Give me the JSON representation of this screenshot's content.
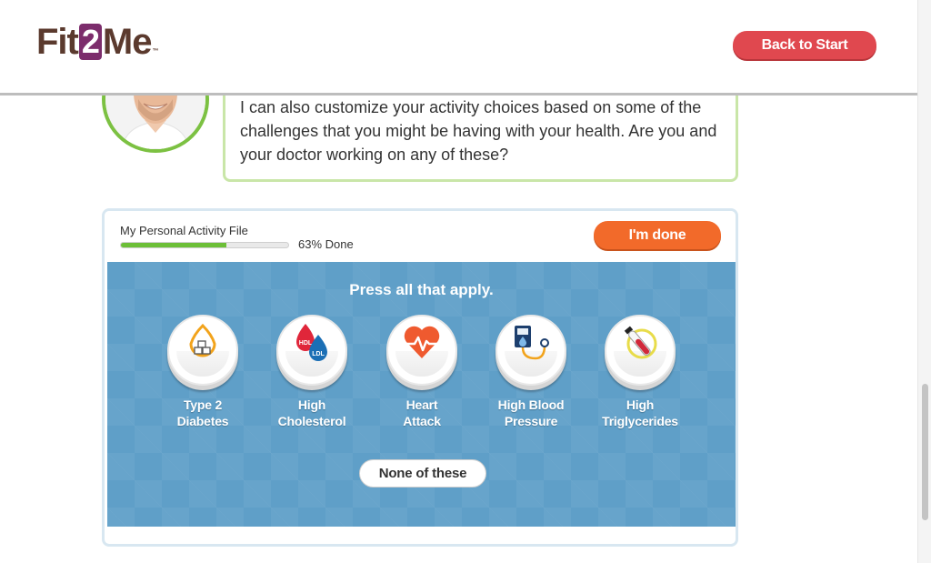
{
  "header": {
    "logo": {
      "part1": "Fit",
      "part2": "2",
      "part3": "Me",
      "tm": "™"
    },
    "back_button": "Back to Start"
  },
  "coach": {
    "message": "I can also customize your activity choices based on some of the challenges that you might be having with your health. Are you and your doctor working on any of these?"
  },
  "activity_file": {
    "title": "My Personal Activity File",
    "progress_percent": 63,
    "progress_text": "63% Done",
    "done_button": "I'm done"
  },
  "question": {
    "instruction": "Press all that apply.",
    "options": [
      {
        "label_line1": "Type 2",
        "label_line2": "Diabetes",
        "icon": "sugar-cubes-icon"
      },
      {
        "label_line1": "High",
        "label_line2": "Cholesterol",
        "icon": "cholesterol-drops-icon",
        "icon_text_1": "HDL",
        "icon_text_2": "LDL"
      },
      {
        "label_line1": "Heart",
        "label_line2": "Attack",
        "icon": "heart-pulse-icon"
      },
      {
        "label_line1": "High Blood",
        "label_line2": "Pressure",
        "icon": "blood-pressure-monitor-icon"
      },
      {
        "label_line1": "High",
        "label_line2": "Triglycerides",
        "icon": "test-tube-icon"
      }
    ],
    "none_button": "None of these"
  },
  "colors": {
    "brand_brown": "#5b3a2e",
    "brand_purple": "#7c2d6c",
    "back_button": "#e0484f",
    "done_button": "#f26a2a",
    "progress_fill": "#6cbf37",
    "question_bg": "#5f9fc8",
    "coach_border": "#c9e6a8"
  }
}
